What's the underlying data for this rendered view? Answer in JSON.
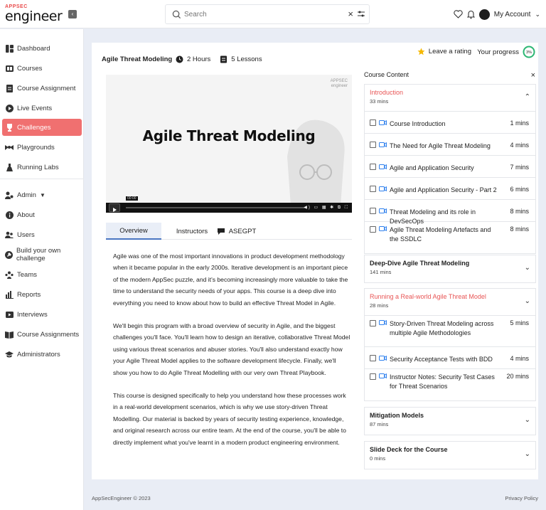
{
  "brand": {
    "top": "APPSEC",
    "bottom": "engineer"
  },
  "search": {
    "placeholder": "Search"
  },
  "user": {
    "label": "My Account"
  },
  "sidebar": {
    "items": [
      {
        "label": "Dashboard",
        "icon": "dashboard-icon"
      },
      {
        "label": "Courses",
        "icon": "courses-icon"
      },
      {
        "label": "Course Assignment",
        "icon": "assignment-icon"
      },
      {
        "label": "Live Events",
        "icon": "play-circle-icon"
      },
      {
        "label": "Challenges",
        "icon": "trophy-icon"
      },
      {
        "label": "Playgrounds",
        "icon": "playground-icon"
      },
      {
        "label": "Running Labs",
        "icon": "flask-icon"
      }
    ],
    "admin": [
      {
        "label": "Admin",
        "icon": "admin-icon"
      },
      {
        "label": "About",
        "icon": "info-icon"
      },
      {
        "label": "Users",
        "icon": "users-icon"
      },
      {
        "label": "Build your own challenge",
        "icon": "build-icon"
      },
      {
        "label": "Teams",
        "icon": "teams-icon"
      },
      {
        "label": "Reports",
        "icon": "reports-icon"
      },
      {
        "label": "Interviews",
        "icon": "interviews-icon"
      },
      {
        "label": "Course Assignments",
        "icon": "book-icon"
      },
      {
        "label": "Administrators",
        "icon": "graduation-icon"
      }
    ]
  },
  "course": {
    "title": "Agile Threat Modeling",
    "duration": "2 Hours",
    "lessons": "5 Lessons",
    "rating_label": "Leave a rating",
    "progress_label": "Your progress",
    "progress_value": "3%"
  },
  "video": {
    "title": "Agile Threat Modeling",
    "time": "00:00"
  },
  "tabs": [
    {
      "label": "Overview"
    },
    {
      "label": "Instructors"
    },
    {
      "label": "ASEGPT"
    }
  ],
  "overview": [
    "Agile was one of the most important innovations in product development methodology when it became popular in the early 2000s. Iterative development is an important piece of the modern AppSec puzzle, and it's becoming increasingly more valuable to take the time to understand the security needs of your apps. This course is a deep dive into everything you need to know about how to build an effective Threat Model in Agile.",
    "We'll begin this program with a broad overview of security in Agile, and the biggest challenges you'll face. You'll learn how to design an iterative, collaborative Threat Model using various threat scenarios and abuser stories. You'll also understand exactly how your Agile Threat Model applies to the software development lifecycle. Finally, we'll show you how to do Agile Threat Modelling with our very own Threat Playbook.",
    "This course is designed specifically to help you understand how these processes work in a real-world development scenarios, which is why we use story-driven Threat Modelling. Our material is backed by years of security testing experience, knowledge, and original research across our entire team. At the end of the course, you'll be able to directly implement what you've learnt in a modern product engineering environment."
  ],
  "course_content": {
    "header": "Course Content",
    "sections": [
      {
        "title": "Introduction",
        "duration": "33 mins",
        "expanded": true,
        "lessons": [
          {
            "title": "Course Introduction",
            "duration": "1 mins"
          },
          {
            "title": "The Need for Agile Threat Modeling",
            "duration": "4 mins"
          },
          {
            "title": "Agile and Application Security",
            "duration": "7 mins"
          },
          {
            "title": "Agile and Application Security - Part 2",
            "duration": "6 mins"
          },
          {
            "title": "Threat Modeling and its role in DevSecOps",
            "duration": "8 mins"
          },
          {
            "title": "Agile Threat Modeling Artefacts and the SSDLC",
            "duration": "8 mins"
          }
        ]
      },
      {
        "title": "Deep-Dive Agile Threat Modeling",
        "duration": "141 mins",
        "expanded": false
      },
      {
        "title": "Running a Real-world Agile Threat Model",
        "duration": "28 mins",
        "expanded": false,
        "lessons": [
          {
            "title": "Story-Driven Threat Modeling across multiple Agile Methodologies",
            "duration": "5 mins"
          },
          {
            "title": "Security Acceptance Tests with BDD",
            "duration": "4 mins"
          },
          {
            "title": "Instructor Notes: Security Test Cases for Threat Scenarios",
            "duration": "20 mins"
          }
        ]
      },
      {
        "title": "Mitigation Models",
        "duration": "87 mins",
        "expanded": false
      },
      {
        "title": "Slide Deck for the Course",
        "duration": "0 mins",
        "expanded": false
      }
    ]
  },
  "footer": {
    "copyright": "AppSecEngineer © 2023",
    "privacy": "Privacy Policy"
  },
  "colors": {
    "accent": "#f07070",
    "heading_red": "#e85555",
    "progress": "#2bb673",
    "tab_active": "#e9eef7"
  }
}
